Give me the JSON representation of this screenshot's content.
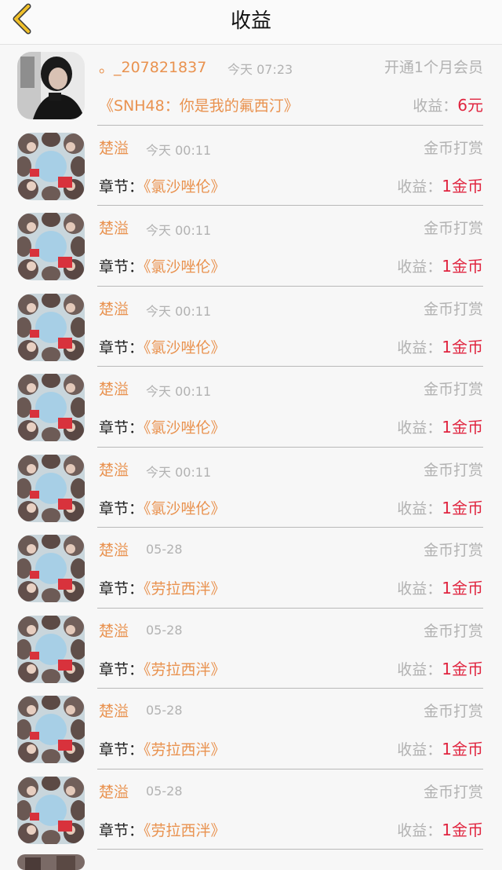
{
  "header": {
    "title": "收益",
    "back_icon": "chevron-left-icon",
    "back_color": "#f0c02a"
  },
  "colors": {
    "accent_orange": "#e9924f",
    "income_red": "#e0243f",
    "gray_text": "#b2b2b2"
  },
  "rows": [
    {
      "avatar": "avatar-photo-dark",
      "name": "。_207821837",
      "time": "今天 07:23",
      "type": "开通1个月会员",
      "chapter_label": "",
      "chapter_title": "《SNH48：你是我的氟西汀》",
      "income_label": "收益：",
      "income_value": "6元"
    },
    {
      "avatar": "avatar-photo-group",
      "name": "楚溢",
      "time": "今天 00:11",
      "type": "金币打赏",
      "chapter_label": "章节：",
      "chapter_title": "《氯沙唑伦》",
      "income_label": "收益：",
      "income_value": "1金币"
    },
    {
      "avatar": "avatar-photo-group",
      "name": "楚溢",
      "time": "今天 00:11",
      "type": "金币打赏",
      "chapter_label": "章节：",
      "chapter_title": "《氯沙唑伦》",
      "income_label": "收益：",
      "income_value": "1金币"
    },
    {
      "avatar": "avatar-photo-group",
      "name": "楚溢",
      "time": "今天 00:11",
      "type": "金币打赏",
      "chapter_label": "章节：",
      "chapter_title": "《氯沙唑伦》",
      "income_label": "收益：",
      "income_value": "1金币"
    },
    {
      "avatar": "avatar-photo-group",
      "name": "楚溢",
      "time": "今天 00:11",
      "type": "金币打赏",
      "chapter_label": "章节：",
      "chapter_title": "《氯沙唑伦》",
      "income_label": "收益：",
      "income_value": "1金币"
    },
    {
      "avatar": "avatar-photo-group",
      "name": "楚溢",
      "time": "今天 00:11",
      "type": "金币打赏",
      "chapter_label": "章节：",
      "chapter_title": "《氯沙唑伦》",
      "income_label": "收益：",
      "income_value": "1金币"
    },
    {
      "avatar": "avatar-photo-group",
      "name": "楚溢",
      "time": "05-28",
      "type": "金币打赏",
      "chapter_label": "章节：",
      "chapter_title": "《劳拉西泮》",
      "income_label": "收益：",
      "income_value": "1金币"
    },
    {
      "avatar": "avatar-photo-group",
      "name": "楚溢",
      "time": "05-28",
      "type": "金币打赏",
      "chapter_label": "章节：",
      "chapter_title": "《劳拉西泮》",
      "income_label": "收益：",
      "income_value": "1金币"
    },
    {
      "avatar": "avatar-photo-group",
      "name": "楚溢",
      "time": "05-28",
      "type": "金币打赏",
      "chapter_label": "章节：",
      "chapter_title": "《劳拉西泮》",
      "income_label": "收益：",
      "income_value": "1金币"
    },
    {
      "avatar": "avatar-photo-group",
      "name": "楚溢",
      "time": "05-28",
      "type": "金币打赏",
      "chapter_label": "章节：",
      "chapter_title": "《劳拉西泮》",
      "income_label": "收益：",
      "income_value": "1金币"
    }
  ]
}
